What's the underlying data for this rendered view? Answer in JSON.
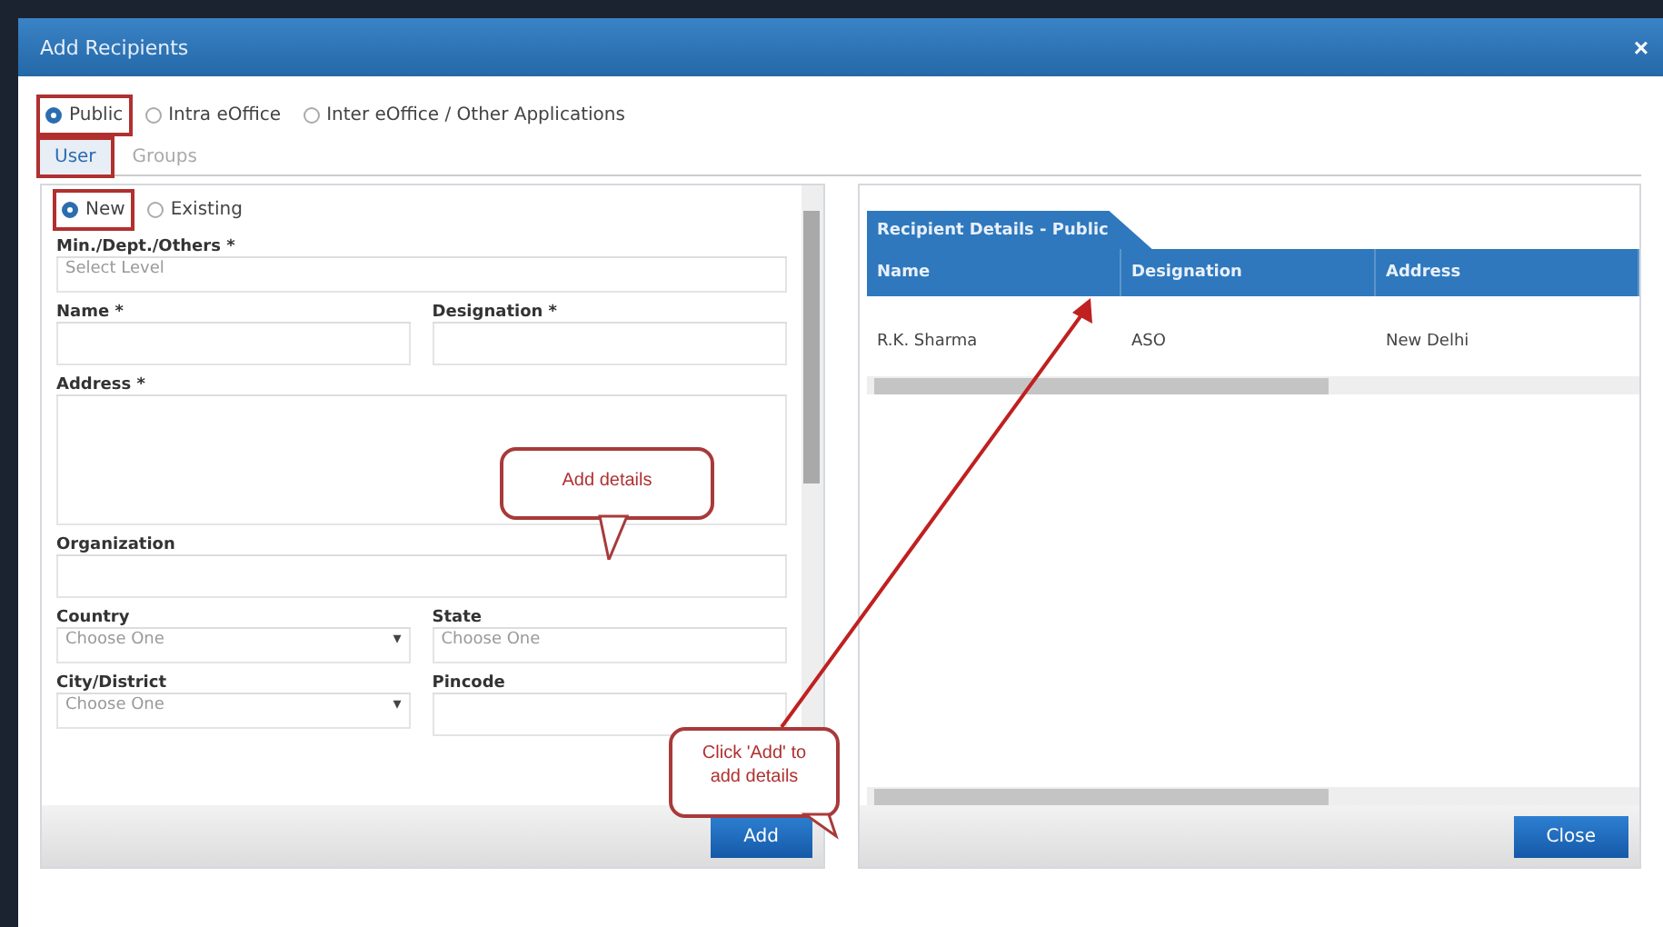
{
  "window": {
    "title": "Add Recipients",
    "close": "×"
  },
  "recipient_types": [
    {
      "label": "Public",
      "selected": true,
      "highlighted": true
    },
    {
      "label": "Intra eOffice",
      "selected": false,
      "highlighted": false
    },
    {
      "label": "Inter eOffice / Other Applications",
      "selected": false,
      "highlighted": false
    }
  ],
  "tabs": [
    {
      "label": "User",
      "selected": true,
      "highlighted": true
    },
    {
      "label": "Groups",
      "selected": false,
      "highlighted": false
    }
  ],
  "user_types": [
    {
      "label": "New",
      "selected": true,
      "highlighted": true
    },
    {
      "label": "Existing",
      "selected": false,
      "highlighted": false
    }
  ],
  "form_rows": [
    [
      {
        "kind": "select",
        "label": "Min./Dept./Others *",
        "placeholder": "Select Level"
      }
    ],
    [
      {
        "kind": "text",
        "label": "Name *"
      },
      {
        "kind": "text",
        "label": "Designation *"
      }
    ],
    [
      {
        "kind": "textarea",
        "label": "Address *"
      }
    ],
    [
      {
        "kind": "text",
        "label": "Organization"
      }
    ],
    [
      {
        "kind": "dropdown",
        "label": "Country",
        "placeholder": "Choose One",
        "caret": "▾"
      },
      {
        "kind": "select",
        "label": "State",
        "placeholder": "Choose One"
      }
    ],
    [
      {
        "kind": "dropdown",
        "label": "City/District",
        "placeholder": "Choose One",
        "caret": "▾"
      },
      {
        "kind": "text",
        "label": "Pincode"
      }
    ]
  ],
  "add_button": "Add",
  "details": {
    "tab": "Recipient Details - Public",
    "columns": [
      "Name",
      "Designation",
      "Address"
    ],
    "rows": [
      [
        "R.K. Sharma",
        "ASO",
        "New Delhi"
      ]
    ]
  },
  "close_button": "Close",
  "callouts": [
    {
      "text": "Add details"
    },
    {
      "text": "Click 'Add' to add details"
    }
  ]
}
